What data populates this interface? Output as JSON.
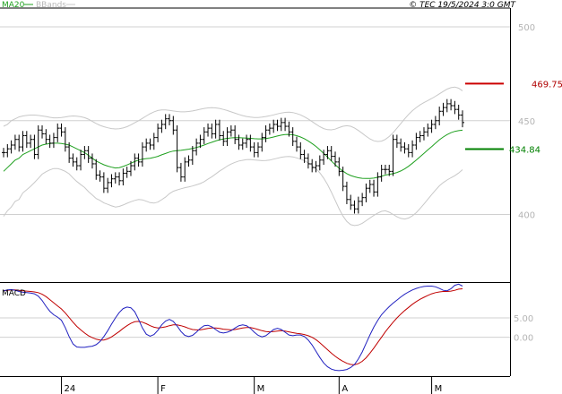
{
  "header": {
    "legend_ma": "MA20",
    "legend_bb": "BBands",
    "copyright": "© TEC 19/5/2024 3:0 GMT"
  },
  "colors": {
    "price": "#000000",
    "ma20": "#1fa01f",
    "bbands": "#c8c8c8",
    "resistance": "#cc0000",
    "support": "#008000",
    "macd": "#2020c0",
    "signal": "#c00000",
    "grid": "#d0d0d0",
    "axis": "#000000"
  },
  "chart_data": [
    {
      "type": "line",
      "panel": "price",
      "y_ticks": [
        {
          "value": 500,
          "label": "500"
        },
        {
          "value": 450,
          "label": "450"
        },
        {
          "value": 400,
          "label": "400"
        }
      ],
      "ylim": [
        364,
        510
      ],
      "x_labels": [
        {
          "index": 15,
          "label": "24"
        },
        {
          "index": 40,
          "label": "F"
        },
        {
          "index": 65,
          "label": "M"
        },
        {
          "index": 87,
          "label": "A"
        },
        {
          "index": 111,
          "label": "M"
        }
      ],
      "levels": [
        {
          "name": "resistance",
          "value": 469.75,
          "label": "469.75"
        },
        {
          "name": "support",
          "value": 434.84,
          "label": "434.84"
        }
      ],
      "close": [
        433,
        435,
        437,
        440,
        436,
        442,
        438,
        440,
        432,
        445,
        443,
        440,
        438,
        441,
        446,
        444,
        436,
        430,
        428,
        426,
        432,
        434,
        430,
        427,
        421,
        420,
        414,
        417,
        419,
        420,
        418,
        422,
        423,
        426,
        430,
        428,
        436,
        438,
        437,
        441,
        446,
        448,
        451,
        450,
        445,
        425,
        420,
        428,
        429,
        434,
        438,
        440,
        444,
        446,
        443,
        448,
        442,
        439,
        444,
        445,
        440,
        437,
        438,
        440,
        436,
        433,
        436,
        441,
        445,
        446,
        448,
        447,
        449,
        447,
        444,
        439,
        436,
        432,
        430,
        427,
        425,
        426,
        429,
        432,
        434,
        431,
        428,
        423,
        415,
        408,
        405,
        403,
        407,
        409,
        414,
        416,
        412,
        420,
        424,
        424,
        423,
        440,
        438,
        436,
        435,
        433,
        437,
        441,
        442,
        444,
        446,
        448,
        450,
        455,
        457,
        459,
        458,
        456,
        453,
        449
      ],
      "ma20": [
        423,
        425,
        427,
        429,
        430,
        432,
        433,
        434,
        435,
        436,
        437,
        437.5,
        437.8,
        438,
        438,
        437.8,
        437.5,
        437,
        436,
        435,
        434,
        433,
        431.5,
        430,
        428.5,
        427.5,
        426.5,
        425.8,
        425.2,
        424.8,
        425,
        425.6,
        426.4,
        427.3,
        428.2,
        429,
        429.5,
        429.8,
        430,
        430.4,
        431,
        431.8,
        432.5,
        433.3,
        433.8,
        434,
        434.2,
        434.5,
        434.8,
        435.2,
        435.7,
        436.3,
        437,
        437.8,
        438.5,
        439.2,
        439.8,
        440.2,
        440.6,
        440.8,
        440.9,
        440.9,
        440.8,
        440.7,
        440.6,
        440.4,
        440.3,
        440.3,
        440.5,
        440.8,
        441.3,
        441.8,
        442.3,
        442.6,
        442.7,
        442.5,
        442,
        441.3,
        440.4,
        439.2,
        437.8,
        436.3,
        434.5,
        432.6,
        430.6,
        428.5,
        426.5,
        424.7,
        423.1,
        421.8,
        420.8,
        420.1,
        419.6,
        419.3,
        419.2,
        419.2,
        419.4,
        419.8,
        420.4,
        421,
        421.4,
        421.8,
        422.4,
        423.2,
        424.3,
        425.7,
        427.3,
        429,
        430.8,
        432.6,
        434.4,
        436.2,
        438,
        439.8,
        441.3,
        442.6,
        443.6,
        444.3,
        444.7,
        444.9
      ],
      "bb_upper": [
        447,
        448,
        450,
        451,
        452,
        452.5,
        452.8,
        453,
        453,
        452.8,
        452.5,
        452.2,
        451.8,
        451.5,
        451.5,
        451.7,
        452,
        452.3,
        452.5,
        452.4,
        452.1,
        451.6,
        450.8,
        449.6,
        448.5,
        447.5,
        446.8,
        446.2,
        445.8,
        445.6,
        445.7,
        446.1,
        446.8,
        447.8,
        448.9,
        450,
        451.2,
        452.5,
        453.7,
        454.7,
        455.4,
        455.7,
        455.7,
        455.5,
        455.2,
        454.9,
        454.7,
        454.7,
        454.9,
        455.2,
        455.6,
        456.1,
        456.5,
        456.8,
        456.9,
        456.8,
        456.5,
        456,
        455.4,
        454.7,
        454,
        453.3,
        452.7,
        452.2,
        451.9,
        451.7,
        451.7,
        451.9,
        452.2,
        452.6,
        453.1,
        453.6,
        454.1,
        454.4,
        454.5,
        454.3,
        453.8,
        453.1,
        452.1,
        450.9,
        449.5,
        448.1,
        446.8,
        445.8,
        445.2,
        445.1,
        445.5,
        446.3,
        447,
        447.3,
        447,
        446.1,
        444.8,
        443.3,
        441.7,
        440.3,
        439.3,
        438.9,
        439.1,
        440,
        441.6,
        443.6,
        446,
        448.5,
        451,
        453.3,
        455.3,
        457,
        458.4,
        459.6,
        460.7,
        461.8,
        463,
        464.3,
        465.6,
        466.8,
        467.6,
        467.9,
        467.3,
        465.9
      ],
      "bb_lower": [
        399,
        402,
        404,
        407,
        408,
        411.5,
        413.2,
        415,
        417,
        419.2,
        421.5,
        422.8,
        423.8,
        424.5,
        424.5,
        423.9,
        423,
        421.7,
        419.5,
        417.6,
        415.9,
        414.4,
        412.2,
        410.4,
        408.5,
        407.5,
        406.2,
        405.4,
        404.6,
        404,
        404.3,
        405.1,
        406,
        406.8,
        407.5,
        408,
        407.8,
        407.1,
        406.3,
        406.1,
        406.6,
        407.9,
        409.3,
        411.1,
        412.4,
        413.1,
        413.7,
        414.3,
        414.7,
        415.2,
        415.8,
        416.5,
        417.5,
        418.8,
        420.1,
        421.6,
        423.1,
        424.4,
        425.8,
        426.9,
        427.8,
        428.5,
        428.9,
        429.2,
        429.3,
        429.1,
        428.9,
        428.7,
        428.8,
        429,
        429.5,
        430,
        430.5,
        430.8,
        430.9,
        430.7,
        430.2,
        429.5,
        428.7,
        427.5,
        426.1,
        424.5,
        422.2,
        419.4,
        416,
        411.9,
        407.5,
        403.1,
        399.2,
        396.3,
        394.6,
        394.1,
        394.4,
        395.3,
        396.7,
        398.1,
        399.5,
        400.7,
        401.7,
        402,
        401.2,
        400,
        398.8,
        397.9,
        397.6,
        398.1,
        399.3,
        401,
        403.2,
        405.6,
        408.1,
        410.6,
        413,
        415.3,
        417,
        418.4,
        419.6,
        420.7,
        422.1,
        423.9
      ]
    },
    {
      "type": "line",
      "panel": "macd",
      "title": "MACD",
      "y_ticks": [
        {
          "value": 5,
          "label": "5.00"
        },
        {
          "value": 0,
          "label": "0.00"
        }
      ],
      "ylim": [
        -10,
        14
      ],
      "macd": [
        12,
        12.2,
        12.3,
        12.1,
        11.8,
        11.6,
        11.5,
        11.4,
        11.2,
        10.6,
        9.5,
        8,
        6.7,
        5.8,
        5.2,
        4.4,
        2.5,
        0.2,
        -1.7,
        -2.5,
        -2.6,
        -2.6,
        -2.4,
        -2.3,
        -1.9,
        -1.1,
        0.2,
        1.7,
        3.4,
        5,
        6.4,
        7.4,
        7.8,
        7.6,
        6.6,
        4.6,
        2.4,
        0.8,
        0.3,
        0.7,
        1.8,
        3.2,
        4.2,
        4.6,
        4.1,
        2.9,
        1.5,
        0.5,
        0.2,
        0.5,
        1.3,
        2.3,
        3,
        3.1,
        2.7,
        2,
        1.3,
        1.1,
        1.3,
        1.7,
        2.4,
        3,
        3.2,
        3,
        2.3,
        1.3,
        0.5,
        0.1,
        0.4,
        1.2,
        2,
        2.3,
        2,
        1.3,
        0.6,
        0.4,
        0.6,
        0.6,
        0.2,
        -0.7,
        -2,
        -3.6,
        -5.2,
        -6.6,
        -7.6,
        -8.2,
        -8.5,
        -8.6,
        -8.5,
        -8.3,
        -7.8,
        -7,
        -5.6,
        -3.8,
        -1.6,
        0.6,
        2.6,
        4.3,
        5.8,
        6.9,
        7.9,
        8.8,
        9.6,
        10.4,
        11.1,
        11.7,
        12.2,
        12.6,
        12.9,
        13.1,
        13.2,
        13.2,
        13,
        12.6,
        12.1,
        12,
        12.5,
        13.4,
        13.7,
        13.2
      ],
      "signal": [
        12,
        12.1,
        12.2,
        12.2,
        12.1,
        12,
        11.9,
        11.8,
        11.7,
        11.5,
        11.1,
        10.5,
        9.7,
        8.9,
        8.1,
        7.3,
        6.3,
        5.1,
        3.9,
        2.8,
        1.9,
        1.1,
        0.4,
        -0.1,
        -0.5,
        -0.7,
        -0.7,
        -0.4,
        0.1,
        0.8,
        1.5,
        2.3,
        3,
        3.6,
        4,
        4.1,
        3.9,
        3.5,
        3,
        2.6,
        2.4,
        2.5,
        2.7,
        3,
        3.2,
        3.2,
        3,
        2.7,
        2.3,
        2,
        1.9,
        1.9,
        2.1,
        2.3,
        2.4,
        2.4,
        2.3,
        2.1,
        2,
        1.9,
        2,
        2.2,
        2.4,
        2.5,
        2.5,
        2.3,
        2,
        1.7,
        1.5,
        1.4,
        1.5,
        1.6,
        1.7,
        1.6,
        1.4,
        1.2,
        1,
        0.9,
        0.7,
        0.4,
        0,
        -0.6,
        -1.4,
        -2.3,
        -3.2,
        -4.1,
        -4.9,
        -5.6,
        -6.2,
        -6.7,
        -7,
        -7.1,
        -6.8,
        -6.2,
        -5.3,
        -4.1,
        -2.8,
        -1.4,
        0,
        1.4,
        2.7,
        3.9,
        5,
        6,
        6.9,
        7.7,
        8.5,
        9.2,
        9.8,
        10.3,
        10.8,
        11.2,
        11.5,
        11.7,
        11.8,
        11.8,
        11.9,
        12.1,
        12.4,
        12.5
      ]
    }
  ]
}
